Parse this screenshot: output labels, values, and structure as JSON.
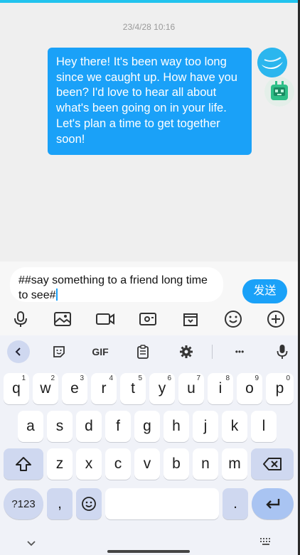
{
  "chat": {
    "timestamp": "23/4/28 10:16",
    "message": "Hey there! It's been way too long since we caught up. How have you been? I'd love to hear all about what's been going on in your life. Let's plan a time to get together soon!"
  },
  "composer": {
    "input_value": "##say something to a friend long time to see#",
    "send_label": "发送",
    "actions": [
      "microphone-icon",
      "image-icon",
      "video-camera-icon",
      "red-packet-icon",
      "folder-icon",
      "emoji-icon",
      "plus-icon"
    ]
  },
  "keyboard": {
    "suggestion_bar": {
      "gif_label": "GIF",
      "more_label": "•••"
    },
    "row1": [
      {
        "k": "q",
        "h": "1"
      },
      {
        "k": "w",
        "h": "2"
      },
      {
        "k": "e",
        "h": "3"
      },
      {
        "k": "r",
        "h": "4"
      },
      {
        "k": "t",
        "h": "5"
      },
      {
        "k": "y",
        "h": "6"
      },
      {
        "k": "u",
        "h": "7"
      },
      {
        "k": "i",
        "h": "8"
      },
      {
        "k": "o",
        "h": "9"
      },
      {
        "k": "p",
        "h": "0"
      }
    ],
    "row2": [
      "a",
      "s",
      "d",
      "f",
      "g",
      "h",
      "j",
      "k",
      "l"
    ],
    "row3": [
      "z",
      "x",
      "c",
      "v",
      "b",
      "n",
      "m"
    ],
    "sym_label": "?123",
    "comma": ",",
    "period": "."
  }
}
